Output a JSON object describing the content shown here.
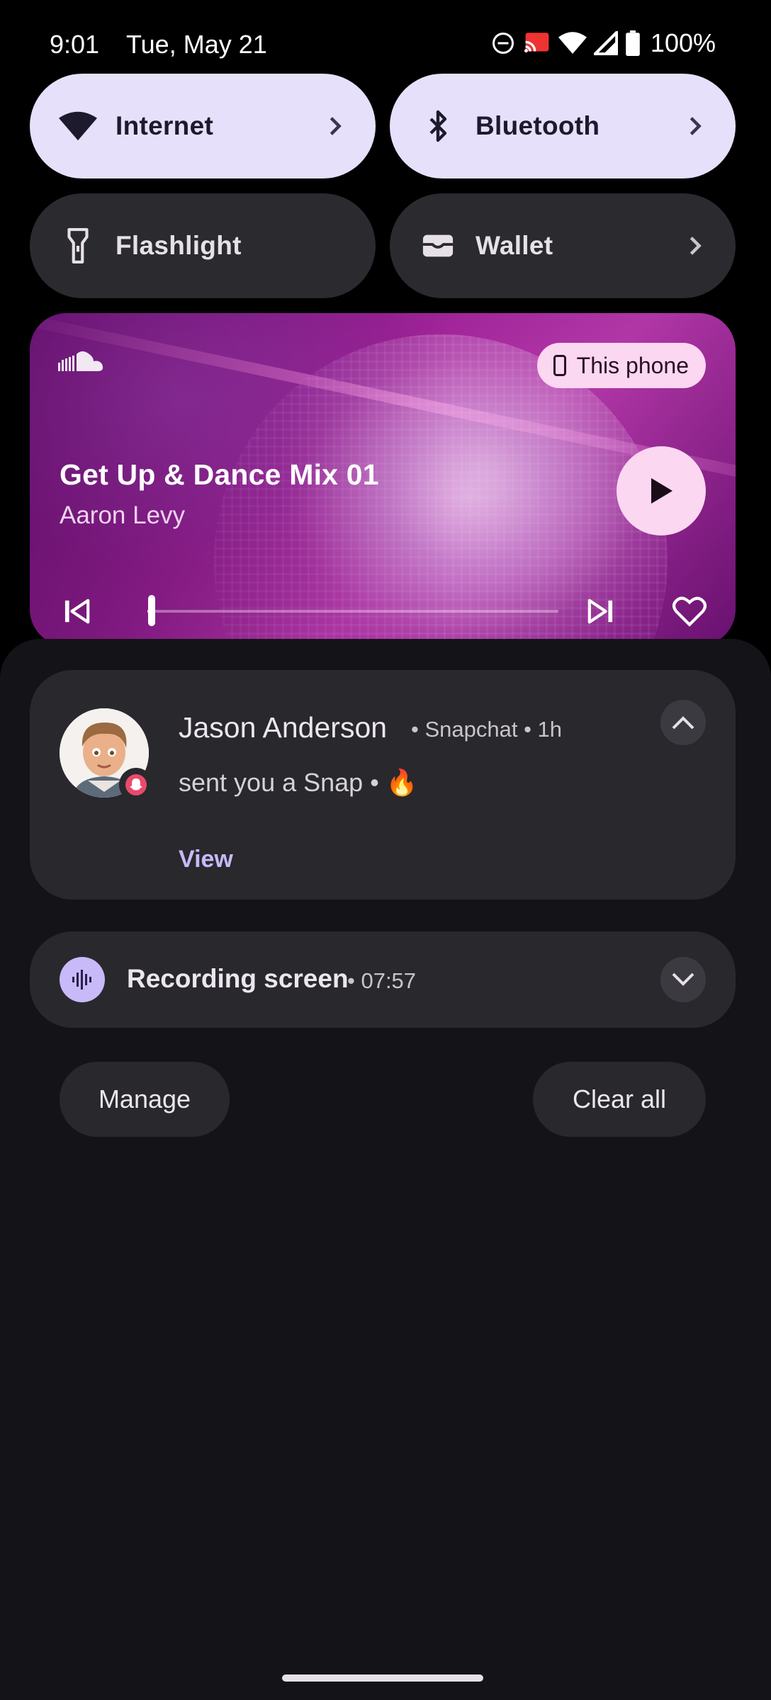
{
  "status_bar": {
    "time": "9:01",
    "date": "Tue, May 21",
    "battery": "100%",
    "icons": [
      "do-not-disturb-icon",
      "cast-icon",
      "wifi-icon",
      "cell-signal-icon",
      "battery-icon"
    ]
  },
  "quick_settings": {
    "tiles": [
      {
        "label": "Internet",
        "icon": "wifi-icon",
        "active": true,
        "has_chevron": true
      },
      {
        "label": "Bluetooth",
        "icon": "bluetooth-icon",
        "active": true,
        "has_chevron": true
      },
      {
        "label": "Flashlight",
        "icon": "flashlight-icon",
        "active": false,
        "has_chevron": false
      },
      {
        "label": "Wallet",
        "icon": "wallet-icon",
        "active": false,
        "has_chevron": true
      }
    ]
  },
  "media": {
    "app_icon": "soundcloud-icon",
    "output_label": "This phone",
    "title": "Get Up & Dance Mix 01",
    "artist": "Aaron Levy",
    "progress": 0.01
  },
  "notifications": [
    {
      "sender": "Jason Anderson",
      "meta": "• Snapchat • 1h",
      "body": "sent you a Snap • 🔥",
      "action": "View"
    },
    {
      "title": "Recording screen",
      "time": "• 07:57"
    }
  ],
  "actions": {
    "manage": "Manage",
    "clear_all": "Clear all"
  },
  "colors": {
    "tile_active": "#e6e0fb",
    "tile_inactive": "#2b2a2f",
    "accent": "#c8b9f8",
    "media_chip": "#fbd7f1"
  }
}
